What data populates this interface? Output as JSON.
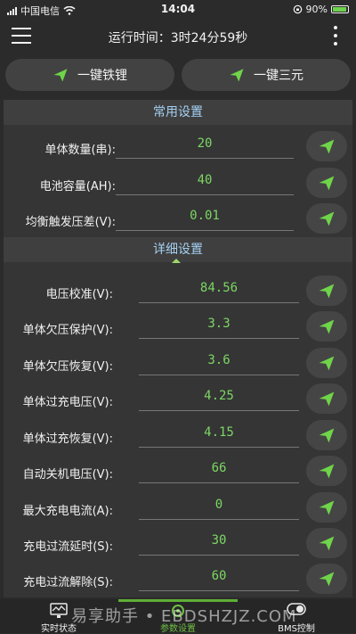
{
  "statusbar": {
    "carrier": "中国电信",
    "time": "14:04",
    "battery": "90%"
  },
  "header": {
    "runtime_label": "运行时间：",
    "runtime_value": "3时24分59秒"
  },
  "quick": {
    "btn1": "一键铁锂",
    "btn2": "一键三元"
  },
  "sections": {
    "common": "常用设置",
    "detail": "详细设置"
  },
  "common_rows": [
    {
      "label": "单体数量(串):",
      "value": "20"
    },
    {
      "label": "电池容量(AH):",
      "value": "40"
    },
    {
      "label": "均衡触发压差(V):",
      "value": "0.01"
    }
  ],
  "detail_rows": [
    {
      "label": "电压校准(V):",
      "value": "84.56"
    },
    {
      "label": "单体欠压保护(V):",
      "value": "3.3"
    },
    {
      "label": "单体欠压恢复(V):",
      "value": "3.6"
    },
    {
      "label": "单体过充电压(V):",
      "value": "4.25"
    },
    {
      "label": "单体过充恢复(V):",
      "value": "4.15"
    },
    {
      "label": "自动关机电压(V):",
      "value": "66"
    },
    {
      "label": "最大充电电流(A):",
      "value": "0"
    },
    {
      "label": "充电过流延时(S):",
      "value": "30"
    },
    {
      "label": "充电过流解除(S):",
      "value": "60"
    }
  ],
  "tabs": {
    "realtime": "实时状态",
    "params": "参数设置",
    "bms": "BMS控制"
  },
  "watermark": "易享助手 • EBDSHZJZ.COM",
  "colors": {
    "value_green": "#7cd764",
    "header_blue": "#a4d0f2",
    "icon_green": "#6fd44a"
  }
}
